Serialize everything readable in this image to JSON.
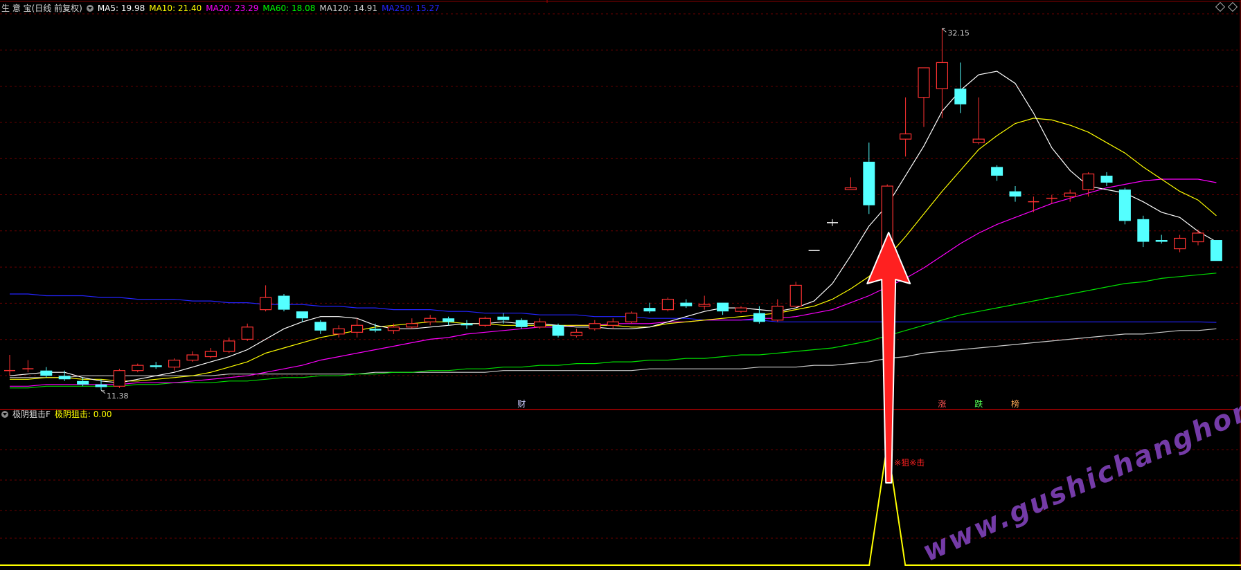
{
  "main_legend": {
    "title": "生 意 宝(日线 前复权)",
    "ma": [
      {
        "label": "MA5: 19.98",
        "color": "#ffffff"
      },
      {
        "label": "MA10: 21.40",
        "color": "#ffff00"
      },
      {
        "label": "MA20: 23.29",
        "color": "#ff00ff"
      },
      {
        "label": "MA60: 18.08",
        "color": "#00ff00"
      },
      {
        "label": "MA120: 14.91",
        "color": "#cccccc"
      },
      {
        "label": "MA250: 15.27",
        "color": "#2424ff"
      }
    ]
  },
  "indicator_legend": {
    "name": "极阴狙击F",
    "value_label": "极阴狙击: 0.00"
  },
  "annotations": {
    "high_label": "32.15",
    "low_label": "11.38",
    "signal_text": "※狙※击",
    "markers": [
      {
        "text": "财",
        "color": "#ccccff"
      },
      {
        "text": "涨",
        "color": "#ff5555"
      },
      {
        "text": "跌",
        "color": "#55ff55"
      },
      {
        "text": "榜",
        "color": "#ffaa55"
      }
    ],
    "watermark": "www.gushichanghong.com"
  },
  "colors": {
    "up": "#ff3232",
    "down": "#54ffff",
    "grid": "#6a0000",
    "arrow": "#ff2020",
    "signal": "#ffff00"
  },
  "chart_data": {
    "type": "candlestick",
    "y_range": [
      10.5,
      33
    ],
    "candles": [
      [
        12.5,
        12.5,
        13.4,
        12.2
      ],
      [
        12.6,
        12.6,
        13.1,
        12.4
      ],
      [
        12.5,
        12.2,
        12.7,
        12.1
      ],
      [
        12.2,
        12.0,
        12.5,
        11.9
      ],
      [
        11.9,
        11.7,
        12.1,
        11.6
      ],
      [
        11.7,
        11.55,
        12.0,
        11.38
      ],
      [
        11.6,
        12.5,
        12.6,
        11.5
      ],
      [
        12.5,
        12.8,
        12.9,
        12.4
      ],
      [
        12.8,
        12.7,
        13.0,
        12.6
      ],
      [
        12.7,
        13.1,
        13.2,
        12.5
      ],
      [
        13.1,
        13.4,
        13.6,
        13.0
      ],
      [
        13.3,
        13.6,
        13.8,
        13.2
      ],
      [
        13.6,
        14.2,
        14.4,
        13.5
      ],
      [
        14.3,
        15.0,
        15.2,
        14.2
      ],
      [
        16.0,
        16.7,
        17.4,
        15.9
      ],
      [
        16.8,
        16.0,
        16.9,
        15.9
      ],
      [
        15.9,
        15.5,
        15.9,
        15.3
      ],
      [
        15.3,
        14.8,
        15.4,
        14.6
      ],
      [
        14.6,
        14.9,
        15.1,
        14.4
      ],
      [
        14.7,
        15.1,
        15.5,
        14.4
      ],
      [
        14.9,
        14.8,
        15.2,
        14.7
      ],
      [
        14.8,
        15.0,
        15.2,
        14.6
      ],
      [
        15.0,
        15.2,
        15.5,
        14.9
      ],
      [
        15.3,
        15.5,
        15.7,
        15.1
      ],
      [
        15.5,
        15.3,
        15.6,
        15.1
      ],
      [
        15.2,
        15.1,
        15.4,
        14.9
      ],
      [
        15.1,
        15.5,
        15.6,
        15.0
      ],
      [
        15.6,
        15.4,
        15.8,
        15.2
      ],
      [
        15.4,
        15.0,
        15.5,
        14.9
      ],
      [
        15.0,
        15.3,
        15.5,
        14.9
      ],
      [
        15.1,
        14.5,
        15.2,
        14.4
      ],
      [
        14.5,
        14.7,
        14.9,
        14.4
      ],
      [
        14.9,
        15.2,
        15.4,
        14.8
      ],
      [
        15.1,
        15.3,
        15.5,
        14.9
      ],
      [
        15.3,
        15.8,
        15.9,
        15.2
      ],
      [
        16.1,
        15.9,
        16.4,
        15.8
      ],
      [
        16.0,
        16.6,
        16.7,
        15.9
      ],
      [
        16.4,
        16.2,
        16.6,
        16.1
      ],
      [
        16.2,
        16.3,
        16.8,
        16.0
      ],
      [
        16.4,
        15.9,
        16.4,
        15.7
      ],
      [
        15.9,
        16.1,
        16.2,
        15.8
      ],
      [
        15.8,
        15.3,
        16.2,
        15.2
      ],
      [
        15.4,
        16.2,
        16.6,
        15.3
      ],
      [
        16.2,
        17.4,
        17.6,
        16.2
      ],
      [
        19.4,
        19.4,
        19.4,
        19.4
      ],
      [
        21.0,
        21.0,
        21.2,
        20.8
      ],
      [
        22.9,
        23.0,
        23.6,
        22.9
      ],
      [
        24.5,
        22.0,
        25.6,
        21.5
      ],
      [
        19.2,
        23.1,
        23.2,
        19.2
      ],
      [
        25.8,
        26.1,
        28.2,
        24.8
      ],
      [
        28.2,
        29.9,
        29.9,
        26.5
      ],
      [
        28.7,
        30.2,
        32.15,
        27.0
      ],
      [
        28.7,
        27.8,
        30.2,
        27.3
      ],
      [
        25.6,
        25.8,
        28.2,
        25.5
      ],
      [
        24.2,
        23.7,
        24.3,
        23.4
      ],
      [
        22.8,
        22.5,
        23.1,
        22.2
      ],
      [
        22.2,
        22.2,
        22.5,
        21.6
      ],
      [
        22.4,
        22.4,
        22.6,
        22.1
      ],
      [
        22.5,
        22.7,
        22.9,
        22.2
      ],
      [
        22.9,
        23.8,
        23.9,
        22.5
      ],
      [
        23.7,
        23.3,
        23.9,
        23.1
      ],
      [
        22.9,
        21.1,
        23.0,
        20.9
      ],
      [
        21.2,
        19.9,
        21.4,
        19.6
      ],
      [
        20.0,
        19.9,
        20.3,
        19.8
      ],
      [
        19.5,
        20.1,
        20.3,
        19.3
      ],
      [
        19.9,
        20.4,
        20.6,
        19.7
      ],
      [
        20.0,
        18.8,
        20.0,
        18.8
      ]
    ],
    "ma5": [
      12.2,
      12.3,
      12.4,
      12.4,
      12.1,
      11.9,
      11.8,
      12.0,
      12.2,
      12.4,
      12.7,
      13.0,
      13.3,
      13.7,
      14.3,
      14.9,
      15.3,
      15.6,
      15.6,
      15.5,
      15.1,
      14.9,
      14.9,
      15.0,
      15.1,
      15.2,
      15.2,
      15.3,
      15.2,
      15.2,
      15.1,
      15.0,
      15.0,
      14.9,
      14.9,
      15.0,
      15.3,
      15.6,
      15.9,
      16.1,
      16.1,
      16.0,
      15.9,
      16.1,
      16.5,
      17.5,
      19.1,
      20.8,
      22.0,
      23.7,
      25.4,
      27.4,
      28.6,
      29.5,
      29.7,
      29.0,
      27.3,
      25.3,
      24.0,
      23.1,
      22.9,
      22.7,
      22.2,
      21.6,
      21.3,
      20.5,
      19.9
    ],
    "ma10": [
      12.0,
      12.0,
      12.1,
      12.1,
      12.0,
      12.0,
      11.9,
      11.9,
      12.0,
      12.1,
      12.2,
      12.4,
      12.7,
      13.0,
      13.5,
      13.8,
      14.1,
      14.4,
      14.6,
      14.8,
      15.0,
      15.1,
      15.2,
      15.3,
      15.3,
      15.2,
      15.2,
      15.1,
      15.1,
      15.1,
      15.1,
      15.1,
      15.1,
      15.1,
      15.0,
      15.0,
      15.2,
      15.3,
      15.4,
      15.5,
      15.6,
      15.7,
      15.8,
      16.0,
      16.2,
      16.6,
      17.2,
      17.9,
      19.0,
      20.2,
      21.5,
      22.8,
      24.0,
      25.2,
      26.0,
      26.7,
      27.0,
      26.9,
      26.6,
      26.2,
      25.6,
      25.0,
      24.2,
      23.5,
      22.8,
      22.3,
      21.4
    ],
    "ma20": [
      11.6,
      11.6,
      11.7,
      11.7,
      11.7,
      11.7,
      11.7,
      11.8,
      11.8,
      11.8,
      11.9,
      12.0,
      12.1,
      12.2,
      12.4,
      12.6,
      12.8,
      13.1,
      13.3,
      13.5,
      13.7,
      13.9,
      14.1,
      14.3,
      14.4,
      14.6,
      14.7,
      14.8,
      14.9,
      15.0,
      15.0,
      15.1,
      15.1,
      15.2,
      15.2,
      15.2,
      15.3,
      15.3,
      15.4,
      15.4,
      15.4,
      15.5,
      15.5,
      15.6,
      15.8,
      16.0,
      16.4,
      16.8,
      17.3,
      17.8,
      18.4,
      19.1,
      19.8,
      20.4,
      20.9,
      21.3,
      21.7,
      22.1,
      22.4,
      22.7,
      23.0,
      23.2,
      23.4,
      23.5,
      23.5,
      23.5,
      23.3
    ],
    "ma60": [
      11.5,
      11.5,
      11.6,
      11.6,
      11.6,
      11.6,
      11.6,
      11.7,
      11.7,
      11.8,
      11.8,
      11.8,
      11.9,
      11.9,
      12.0,
      12.1,
      12.1,
      12.2,
      12.2,
      12.3,
      12.3,
      12.4,
      12.4,
      12.5,
      12.5,
      12.6,
      12.6,
      12.7,
      12.7,
      12.8,
      12.8,
      12.9,
      12.9,
      13.0,
      13.0,
      13.1,
      13.1,
      13.2,
      13.2,
      13.3,
      13.4,
      13.4,
      13.5,
      13.6,
      13.7,
      13.8,
      14.0,
      14.2,
      14.5,
      14.8,
      15.1,
      15.4,
      15.7,
      15.9,
      16.1,
      16.3,
      16.5,
      16.7,
      16.9,
      17.1,
      17.3,
      17.5,
      17.6,
      17.8,
      17.9,
      18.0,
      18.1
    ],
    "ma120": [
      12.1,
      12.1,
      12.1,
      12.1,
      12.2,
      12.2,
      12.2,
      12.2,
      12.2,
      12.2,
      12.2,
      12.2,
      12.3,
      12.3,
      12.3,
      12.3,
      12.3,
      12.3,
      12.3,
      12.3,
      12.4,
      12.4,
      12.4,
      12.4,
      12.4,
      12.4,
      12.4,
      12.5,
      12.5,
      12.5,
      12.5,
      12.5,
      12.5,
      12.5,
      12.5,
      12.6,
      12.6,
      12.6,
      12.6,
      12.6,
      12.6,
      12.7,
      12.7,
      12.7,
      12.8,
      12.8,
      12.9,
      13.0,
      13.2,
      13.3,
      13.5,
      13.6,
      13.7,
      13.8,
      13.9,
      14.0,
      14.1,
      14.2,
      14.3,
      14.4,
      14.5,
      14.6,
      14.6,
      14.7,
      14.8,
      14.8,
      14.9
    ],
    "ma250": [
      16.9,
      16.9,
      16.8,
      16.8,
      16.8,
      16.7,
      16.7,
      16.6,
      16.6,
      16.6,
      16.5,
      16.5,
      16.4,
      16.4,
      16.3,
      16.3,
      16.3,
      16.2,
      16.2,
      16.1,
      16.1,
      16.0,
      16.0,
      16.0,
      15.9,
      15.9,
      15.8,
      15.8,
      15.8,
      15.7,
      15.7,
      15.7,
      15.6,
      15.6,
      15.6,
      15.5,
      15.5,
      15.5,
      15.4,
      15.4,
      15.4,
      15.4,
      15.3,
      15.3,
      15.3,
      15.3,
      15.3,
      15.3,
      15.3,
      15.3,
      15.3,
      15.3,
      15.3,
      15.3,
      15.3,
      15.3,
      15.3,
      15.3,
      15.3,
      15.3,
      15.3,
      15.3,
      15.3,
      15.3,
      15.3,
      15.3,
      15.27
    ],
    "indicator": {
      "name": "极阴狙击",
      "baseline": 0,
      "peak": 1,
      "peak_index": 48
    }
  }
}
